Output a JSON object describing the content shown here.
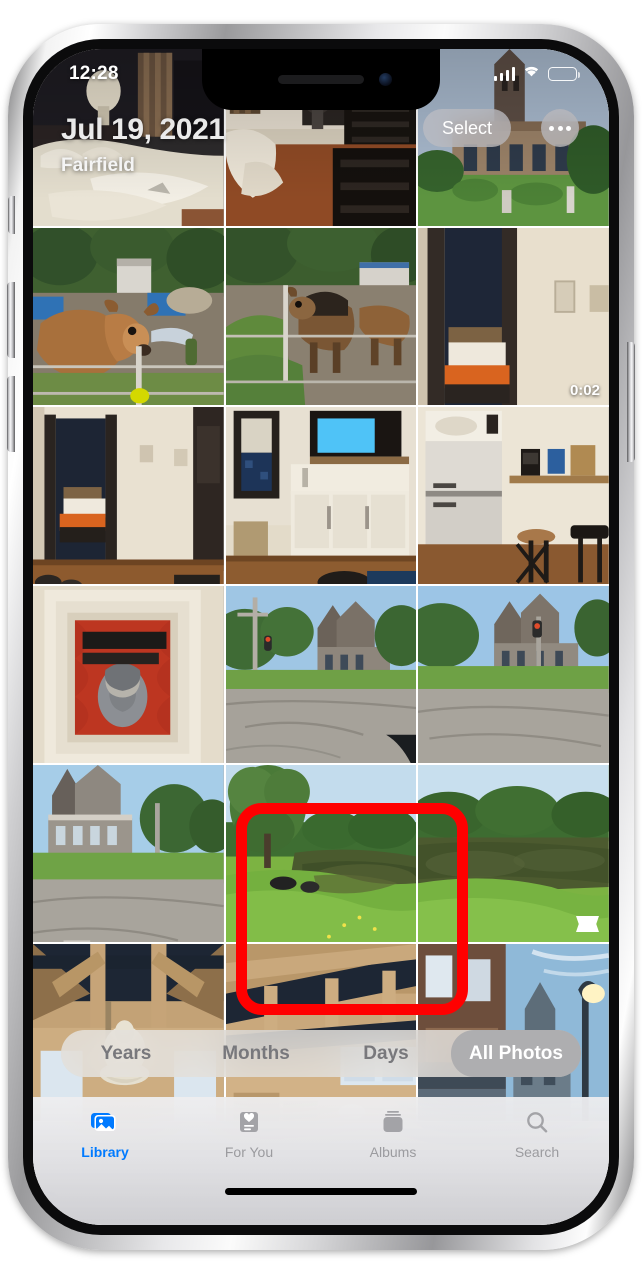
{
  "status_bar": {
    "time": "12:28",
    "cellular_icon": "cellular-signal-icon",
    "wifi_icon": "wifi-icon",
    "battery_icon": "battery-icon",
    "battery_level_percent": 26
  },
  "header": {
    "date_title": "Jul 19, 2021",
    "location": "Fairfield",
    "select_label": "Select",
    "more_icon": "ellipsis-icon"
  },
  "photos": [
    {
      "id": "p1",
      "description": "Hotel bed with white linens and lamp",
      "badge": null
    },
    {
      "id": "p2",
      "description": "Hotel room desk with office chair and dark dresser",
      "badge": null
    },
    {
      "id": "p3",
      "description": "Brick courthouse building with green lawn",
      "badge": null
    },
    {
      "id": "p4",
      "description": "Brown jersey cow at fence being fed",
      "badge": null
    },
    {
      "id": "p5",
      "description": "Brown and black cows in muddy pasture",
      "badge": null
    },
    {
      "id": "p6",
      "description": "Bedroom doorway with orange bedspread",
      "badge": "duration",
      "duration": "0:02"
    },
    {
      "id": "p7",
      "description": "Hallway looking into navy bedroom with orange bed",
      "badge": null
    },
    {
      "id": "p8",
      "description": "Kitchenette with white cabinets, sink and TV",
      "badge": null
    },
    {
      "id": "p9",
      "description": "Stainless fridge, microwave, coffee maker and bar stools",
      "badge": null
    },
    {
      "id": "p10",
      "description": "Framed Willie for President poster on wall",
      "badge": null
    },
    {
      "id": "p11",
      "description": "Victorian house across street intersection",
      "badge": null
    },
    {
      "id": "p12",
      "description": "Victorian house from street corner with traffic light",
      "badge": null
    },
    {
      "id": "p13",
      "description": "Gray Victorian mansion beside road",
      "badge": null
    },
    {
      "id": "p14",
      "description": "Pond with large tree and grassy bank",
      "badge": null,
      "highlighted": true
    },
    {
      "id": "p15",
      "description": "Panoramic pond with treeline reflection",
      "badge": "panorama"
    },
    {
      "id": "p16",
      "description": "Timber frame ceiling with hanging chandelier",
      "badge": null
    },
    {
      "id": "p17",
      "description": "Timber frame barn interior with balcony",
      "badge": null
    },
    {
      "id": "p18",
      "description": "Brick downtown street with lamp post at dusk",
      "badge": null
    }
  ],
  "annotation": {
    "type": "highlight-rectangle",
    "color": "#ff0000",
    "target_photo_id": "p14"
  },
  "segmented_control": {
    "options": [
      "Years",
      "Months",
      "Days",
      "All Photos"
    ],
    "selected": "All Photos"
  },
  "tab_bar": {
    "items": [
      {
        "label": "Library",
        "icon": "photo-stack-icon",
        "active": true
      },
      {
        "label": "For You",
        "icon": "heart-card-icon",
        "active": false
      },
      {
        "label": "Albums",
        "icon": "albums-icon",
        "active": false
      },
      {
        "label": "Search",
        "icon": "search-icon",
        "active": false
      }
    ],
    "accent_color": "#007aff",
    "inactive_color": "#9b9b9f"
  }
}
